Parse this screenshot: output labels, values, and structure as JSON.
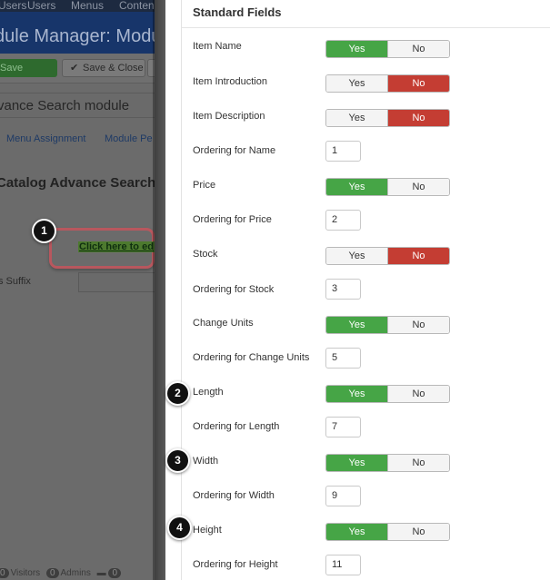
{
  "background": {
    "nav": [
      "Users",
      "Menus",
      "Conten"
    ],
    "page_title": "dule Manager: Module J",
    "toolbar": {
      "save_label": "Save",
      "save_close_label": "Save & Close",
      "save_close_icon": "check-icon"
    },
    "title_field_value": "vance Search module",
    "tabs": [
      "Menu Assignment",
      "Module Pe"
    ],
    "section_heading": "Catalog Advance Search",
    "edit_link": "Click here to ed",
    "suffix_label": "s Suffix",
    "status_bar": {
      "visitors_count": "0",
      "visitors_label": "Visitors",
      "admins_count": "0",
      "admins_label": "Admins",
      "messages_count": "0"
    }
  },
  "modal": {
    "legend": "Standard Fields",
    "toggle_yes": "Yes",
    "toggle_no": "No",
    "rows": [
      {
        "label": "Item Name",
        "type": "toggle",
        "value": "Yes"
      },
      {
        "label": "Item Introduction",
        "type": "toggle",
        "value": "No"
      },
      {
        "label": "Item Description",
        "type": "toggle",
        "value": "No"
      },
      {
        "label": "Ordering for Name",
        "type": "number",
        "value": "1"
      },
      {
        "label": "Price",
        "type": "toggle",
        "value": "Yes"
      },
      {
        "label": "Ordering for Price",
        "type": "number",
        "value": "2"
      },
      {
        "label": "Stock",
        "type": "toggle",
        "value": "No"
      },
      {
        "label": "Ordering for Stock",
        "type": "number",
        "value": "3"
      },
      {
        "label": "Change Units",
        "type": "toggle",
        "value": "Yes"
      },
      {
        "label": "Ordering for Change Units",
        "type": "number",
        "value": "5"
      },
      {
        "label": "Length",
        "type": "toggle",
        "value": "Yes"
      },
      {
        "label": "Ordering for Length",
        "type": "number",
        "value": "7"
      },
      {
        "label": "Width",
        "type": "toggle",
        "value": "Yes"
      },
      {
        "label": "Ordering for Width",
        "type": "number",
        "value": "9"
      },
      {
        "label": "Height",
        "type": "toggle",
        "value": "Yes"
      },
      {
        "label": "Ordering for Height",
        "type": "number",
        "value": "11"
      }
    ]
  },
  "callouts": [
    "1",
    "2",
    "3",
    "4"
  ],
  "colors": {
    "yes_active": "#46a546",
    "no_active": "#c43d33",
    "callout_outline": "#b8575e"
  }
}
